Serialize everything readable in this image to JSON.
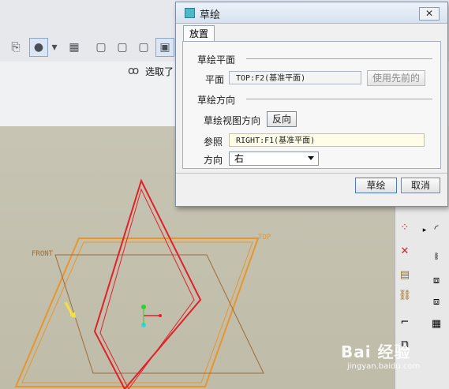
{
  "app": {
    "selected_label": "选取了"
  },
  "viewport": {
    "top_label": "TOP",
    "front_label": "FRONT"
  },
  "dialog": {
    "title": "草绘",
    "close_symbol": "✕",
    "tab": "放置",
    "sketch_plane_section": "草绘平面",
    "plane_label": "平面",
    "plane_value": "TOP:F2(基准平面)",
    "use_previous_button": "使用先前的",
    "sketch_orientation_section": "草绘方向",
    "view_direction_label": "草绘视图方向",
    "flip_button": "反向",
    "reference_label": "参照",
    "reference_value": "RIGHT:F1(基准平面)",
    "orientation_label": "方向",
    "orientation_value": "右",
    "sketch_button": "草绘",
    "cancel_button": "取消"
  },
  "watermark": {
    "brand": "Bai 经验",
    "site": "jingyan.baidu.com"
  }
}
